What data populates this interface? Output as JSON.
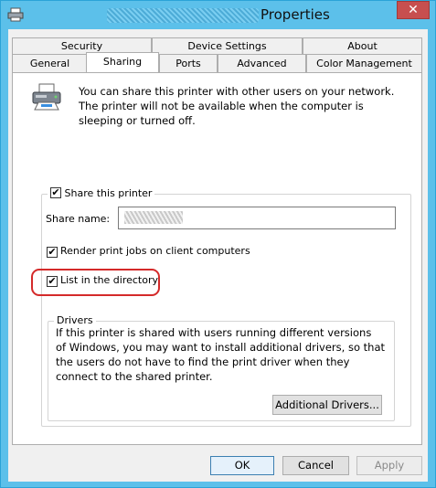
{
  "window": {
    "title": "Properties",
    "close_glyph": "✕"
  },
  "tabs": {
    "row1": [
      "Security",
      "Device Settings",
      "About"
    ],
    "row2": [
      "General",
      "Sharing",
      "Ports",
      "Advanced",
      "Color Management"
    ],
    "active": "Sharing"
  },
  "sharing": {
    "intro_text": "You can share this printer with other users on your network. The printer will not be available when the computer is sleeping or turned off.",
    "share_printer": {
      "label": "Share this printer",
      "checked": true
    },
    "share_name_label": "Share name:",
    "render_jobs": {
      "label": "Render print jobs on client computers",
      "checked": true
    },
    "list_directory": {
      "label": "List in the directory",
      "checked": true
    },
    "drivers": {
      "title": "Drivers",
      "text": "If this printer is shared with users running different versions of Windows, you may want to install additional drivers, so that the users do not have to find the print driver when they connect to the shared printer.",
      "button": "Additional Drivers..."
    }
  },
  "footer": {
    "ok": "OK",
    "cancel": "Cancel",
    "apply": "Apply"
  },
  "check_glyph": "✔",
  "colors": {
    "titlebar": "#5cc0ea",
    "highlight": "#d42a2a"
  }
}
